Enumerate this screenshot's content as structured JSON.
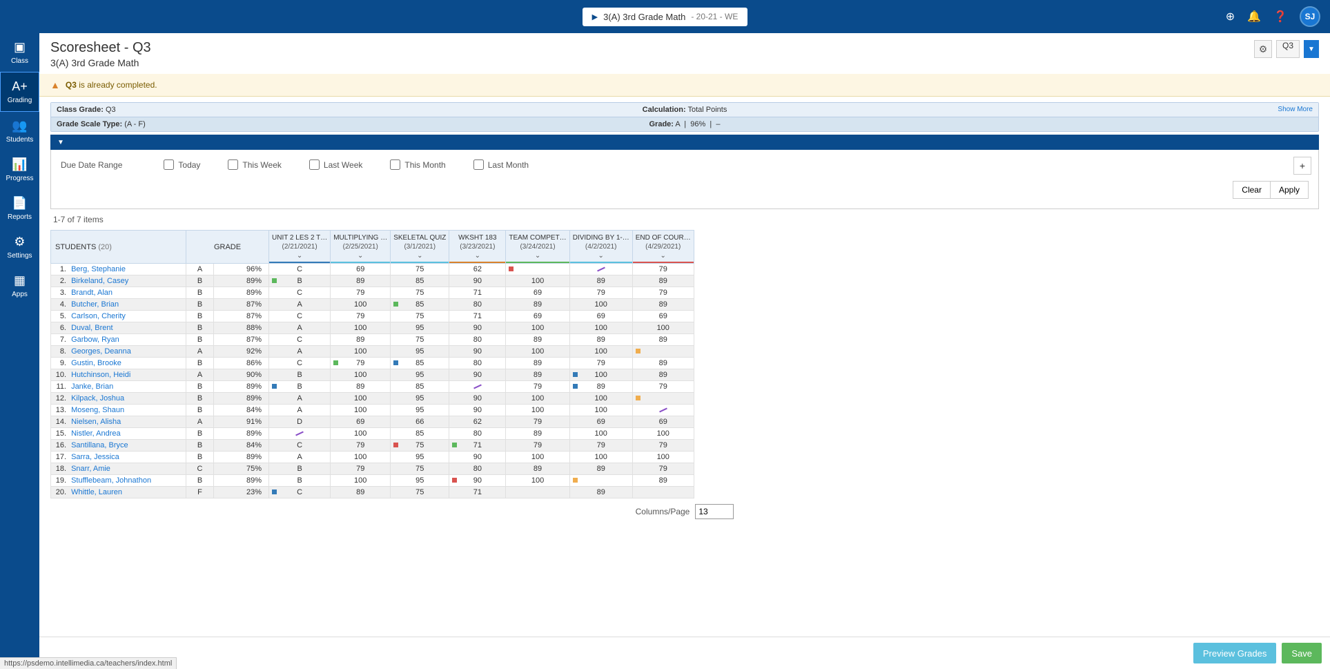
{
  "topbar": {
    "class_name": "3(A) 3rd Grade Math",
    "class_suffix": "- 20-21 - WE",
    "avatar": "SJ"
  },
  "sidebar": [
    {
      "label": "Class",
      "icon": "▣"
    },
    {
      "label": "Grading",
      "icon": "A+",
      "active": true
    },
    {
      "label": "Students",
      "icon": "👥"
    },
    {
      "label": "Progress",
      "icon": "📊"
    },
    {
      "label": "Reports",
      "icon": "📄"
    },
    {
      "label": "Settings",
      "icon": "⚙"
    },
    {
      "label": "Apps",
      "icon": "▦"
    }
  ],
  "page": {
    "title": "Scoresheet - Q3",
    "subtitle": "3(A) 3rd Grade Math",
    "term": "Q3"
  },
  "warning": {
    "bold": "Q3",
    "text": "is already completed."
  },
  "class_info": {
    "class_grade_label": "Class Grade:",
    "class_grade_value": "Q3",
    "calc_label": "Calculation:",
    "calc_value": "Total Points",
    "show_more": "Show More",
    "scale_label": "Grade Scale Type:",
    "scale_value": "(A - F)",
    "grade_label": "Grade:",
    "grade_value": "A",
    "grade_pct": "96%",
    "grade_dash": "–"
  },
  "filter": {
    "label": "Due Date Range",
    "options": [
      "Today",
      "This Week",
      "Last Week",
      "This Month",
      "Last Month"
    ],
    "clear": "Clear",
    "apply": "Apply"
  },
  "pager": "1-7 of 7 items",
  "students_header": "STUDENTS",
  "students_count": "(20)",
  "grade_header": "GRADE",
  "assignments": [
    {
      "name": "UNIT 2 LES 2 T…",
      "date": "(2/21/2021)",
      "color": "#337ab7"
    },
    {
      "name": "MULTIPLYING …",
      "date": "(2/25/2021)",
      "color": "#5bc0de"
    },
    {
      "name": "SKELETAL QUIZ",
      "date": "(3/1/2021)",
      "color": "#5bc0de"
    },
    {
      "name": "WKSHT 183",
      "date": "(3/23/2021)",
      "color": "#d9822b"
    },
    {
      "name": "TEAM COMPET…",
      "date": "(3/24/2021)",
      "color": "#5cb85c"
    },
    {
      "name": "DIVIDING BY 1-…",
      "date": "(4/2/2021)",
      "color": "#5bc0de"
    },
    {
      "name": "END OF COUR…",
      "date": "(4/29/2021)",
      "color": "#d9534f"
    }
  ],
  "rows": [
    {
      "n": 1,
      "name": "Berg, Stephanie",
      "g": "A",
      "p": "96%",
      "s": [
        "C",
        "69",
        "75",
        "62",
        "",
        "",
        "79"
      ],
      "m": {
        "4": "red",
        "5": "purple"
      }
    },
    {
      "n": 2,
      "name": "Birkeland, Casey",
      "g": "B",
      "p": "89%",
      "s": [
        "B",
        "89",
        "85",
        "90",
        "100",
        "89",
        "89"
      ],
      "m": {
        "0": "green"
      }
    },
    {
      "n": 3,
      "name": "Brandt, Alan",
      "g": "B",
      "p": "89%",
      "s": [
        "C",
        "79",
        "75",
        "71",
        "69",
        "79",
        "79"
      ]
    },
    {
      "n": 4,
      "name": "Butcher, Brian",
      "g": "B",
      "p": "87%",
      "s": [
        "A",
        "100",
        "85",
        "80",
        "89",
        "100",
        "89"
      ],
      "m": {
        "2": "green"
      }
    },
    {
      "n": 5,
      "name": "Carlson, Cherity",
      "g": "B",
      "p": "87%",
      "s": [
        "C",
        "79",
        "75",
        "71",
        "69",
        "69",
        "69"
      ]
    },
    {
      "n": 6,
      "name": "Duval, Brent",
      "g": "B",
      "p": "88%",
      "s": [
        "A",
        "100",
        "95",
        "90",
        "100",
        "100",
        "100"
      ]
    },
    {
      "n": 7,
      "name": "Garbow, Ryan",
      "g": "B",
      "p": "87%",
      "s": [
        "C",
        "89",
        "75",
        "80",
        "89",
        "89",
        "89"
      ]
    },
    {
      "n": 8,
      "name": "Georges, Deanna",
      "g": "A",
      "p": "92%",
      "s": [
        "A",
        "100",
        "95",
        "90",
        "100",
        "100",
        ""
      ],
      "m": {
        "6": "orange"
      }
    },
    {
      "n": 9,
      "name": "Gustin, Brooke",
      "g": "B",
      "p": "86%",
      "s": [
        "C",
        "79",
        "85",
        "80",
        "89",
        "79",
        "89"
      ],
      "m": {
        "1": "green",
        "2": "blue"
      }
    },
    {
      "n": 10,
      "name": "Hutchinson, Heidi",
      "g": "A",
      "p": "90%",
      "s": [
        "B",
        "100",
        "95",
        "90",
        "89",
        "100",
        "89"
      ],
      "m": {
        "5": "blue"
      }
    },
    {
      "n": 11,
      "name": "Janke, Brian",
      "g": "B",
      "p": "89%",
      "s": [
        "B",
        "89",
        "85",
        "",
        "79",
        "89",
        "79"
      ],
      "m": {
        "0": "blue",
        "3": "purple",
        "5": "blue-light"
      }
    },
    {
      "n": 12,
      "name": "Kilpack, Joshua",
      "g": "B",
      "p": "89%",
      "s": [
        "A",
        "100",
        "95",
        "90",
        "100",
        "100",
        ""
      ],
      "m": {
        "6": "orange"
      }
    },
    {
      "n": 13,
      "name": "Moseng, Shaun",
      "g": "B",
      "p": "84%",
      "s": [
        "A",
        "100",
        "95",
        "90",
        "100",
        "100",
        ""
      ],
      "m": {
        "6": "purple"
      }
    },
    {
      "n": 14,
      "name": "Nielsen, Alisha",
      "g": "A",
      "p": "91%",
      "s": [
        "D",
        "69",
        "66",
        "62",
        "79",
        "69",
        "69"
      ]
    },
    {
      "n": 15,
      "name": "Nistler, Andrea",
      "g": "B",
      "p": "89%",
      "s": [
        "",
        "100",
        "85",
        "80",
        "89",
        "100",
        "100"
      ],
      "m": {
        "0": "purple"
      }
    },
    {
      "n": 16,
      "name": "Santillana, Bryce",
      "g": "B",
      "p": "84%",
      "s": [
        "C",
        "79",
        "75",
        "71",
        "79",
        "79",
        "79"
      ],
      "m": {
        "2": "red",
        "3": "green"
      }
    },
    {
      "n": 17,
      "name": "Sarra, Jessica",
      "g": "B",
      "p": "89%",
      "s": [
        "A",
        "100",
        "95",
        "90",
        "100",
        "100",
        "100"
      ]
    },
    {
      "n": 18,
      "name": "Snarr, Amie",
      "g": "C",
      "p": "75%",
      "s": [
        "B",
        "79",
        "75",
        "80",
        "89",
        "89",
        "79"
      ]
    },
    {
      "n": 19,
      "name": "Stufflebeam, Johnathon",
      "g": "B",
      "p": "89%",
      "s": [
        "B",
        "100",
        "95",
        "90",
        "100",
        "",
        "89"
      ],
      "m": {
        "3": "red",
        "5": "orange"
      }
    },
    {
      "n": 20,
      "name": "Whittle, Lauren",
      "g": "F",
      "p": "23%",
      "s": [
        "C",
        "89",
        "75",
        "71",
        "",
        "89",
        ""
      ],
      "m": {
        "0": "blue"
      }
    }
  ],
  "cols_page": {
    "label": "Columns/Page",
    "value": "13"
  },
  "footer": {
    "preview": "Preview Grades",
    "save": "Save"
  },
  "status_url": "https://psdemo.intellimedia.ca/teachers/index.html"
}
